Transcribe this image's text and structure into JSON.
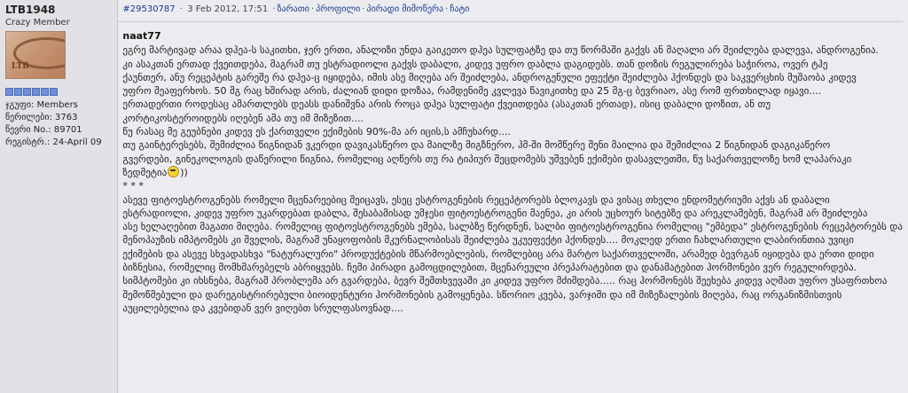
{
  "author": {
    "name": "LTB1948",
    "title": "Crazy Member",
    "avatar_text": "LTB",
    "rep_blocks": 6,
    "group": "ჯგუფი: Members",
    "posts": "წერილები: 3763",
    "member_no": "წევრი No.: 89701",
    "registered": "რეგისტრ.: 24-April 09"
  },
  "header": {
    "post_link": "#29530787",
    "date": "3 Feb 2012, 17:51",
    "links": [
      "ზარათი",
      "პროფილი",
      "პირადი მიმოწერა",
      "ჩატი"
    ]
  },
  "post": {
    "quoted_author": "naat77",
    "lines": [
      "ეგრე მარტივად არაა დჰეა-ს საკითხი, ჯერ ერთი, ანალიზი უნდა გაიკეთო დჰეა სულფატზე და თუ წორმაში გაქვს ან მაღალი არ შეიძლება დალევა, ანდროგენია.",
      "კი ასაკთან ერთად ქვეითდება, მაგრამ თუ ესტრადიოლი გაქვს დაბალი, კიდევ უფრო დაბლა დაგიდებს. თან დოზის რეგულირება საჭიროა, ოვერ ტჰე",
      "ქაუნთერ, ანუ რეცეპტის გარეშე რა დჰეა-ც იყიდება, იმის ასე მიღება არ შეიძლება, ანდროგენული ეფექტი შეიძლება ჰქონდეს და საკვერცხის მუშაობა კიდევ",
      "უფრო შეაფერხოს. 50 მგ რაც ხშირად არის, ძალიან დიდი დოზაა, რამდენიმე კვლევა წავიკითხე და 25 მგ-ც ბევრიაო, ასე რომ ფრთხილად იყავი....",
      "ერთადერთი როდესაც ამართლებს დეასს დანიშვნა არის როცა დჰეა სულფატი ქვეითდება (ასაკთან ერთად), ისიც დაბალი დოზით, ან თუ",
      "კორტიკოსტეროიდებს იღებენ ამა თუ იმ მიზეზით....",
      "წუ რასაც მე გეუბნები კიდევ ეს ქართველი ექიმების 90%-მა არ იცის,ს ამჩუხარდ....",
      "თუ გაინტერესებს, შემიძლია წიგნიდან ვკერდი დავიკასწერო და მაილზე მიგზნერო, ჰმ-ში მომწერე შენი მაილია და შემიძლია 2 წიგნიდან დაგიკაწერო",
      "გვერდები, გინეკოლოგის დაწერილი წიგნია, რომელიც აღწერს თუ რა ტიპიურ შეცდომებს უშვებენ ექიმები დასავლეთში, წუ საქართველოზე ხომ ლაპარაკი",
      "ზედმეტია",
      "* * *",
      "ასევე ფიტოესტროგენებს რომელი მცენარეებიც შეიცავს, ესეც ესტროგენების რეცეპტორებს ბლოკავს და ვისაც თხელი ენდომეტრიუმი აქვს ან დაბალი",
      "ესტრადიოლი, კიდევ უფრო უკარდებათ დაბლა, შესაბამისად უმჯესი ფიტოესტროგენი მაენეა, კი არის უცხოურ სიტებზე და არეკლამებენ, მაგრამ არ შეიძლება",
      "ასე ხელაღებით მაგათი მიღება. რომელიც ფიტოესტროგენებს ემება, სალბზე წერდნენ, სალბი ფიტოესტროგენია რომელიც \"ემბედა\" ესტროგენების რეცეპტორებს და",
      "მენოპაუზის იმპტომებს კი შველის, მაგრამ უნაყოფობის მკურნალობისას შეიძლება უკუეფექტი ჰქონდეს.... მოკლედ ერთი ჩახლართული ლაბირინთია უვიცი",
      "ექიმების და ასევე სხვადასხვა \"ნატურალური\" პროდუქტების მწარმოებლების, რომლებიც არა მარტო საქართველოში, არამედ ბევრგან იყიდება და ერთი დიდი",
      "ბიზნესია, რომელიც მომხმარებელს აბრიყვებს. ჩემი პირადი გამოცდილებით, მცენარეული პრეპარატებით და დანამატებით ჰორმონები ვერ რეგულირდება.",
      "სიმპტომები კი იხსნება, მაგრამ პრობლემა არ გვარდება, ბევრ შემთხვევაში კი კიდევ უფრო მძიმდება..... რაც ჰორმონებს შეეხება კიდევ აღმათ უფრო უსაფრთხოა",
      "შემოწმებული და დარეგისტრირებული ბიოიდენტური ჰორმონების გამოყენება. სწორიო კვება, ვარჯიში და იმ მიზეზალების მიღება, რაც ორგანიზმისთვის",
      "აუცილებელია და კვებიდან ვერ ვიღებთ სრულფასოვნად...."
    ],
    "smiley_after_line": 9,
    "smiley_tail": "))"
  }
}
